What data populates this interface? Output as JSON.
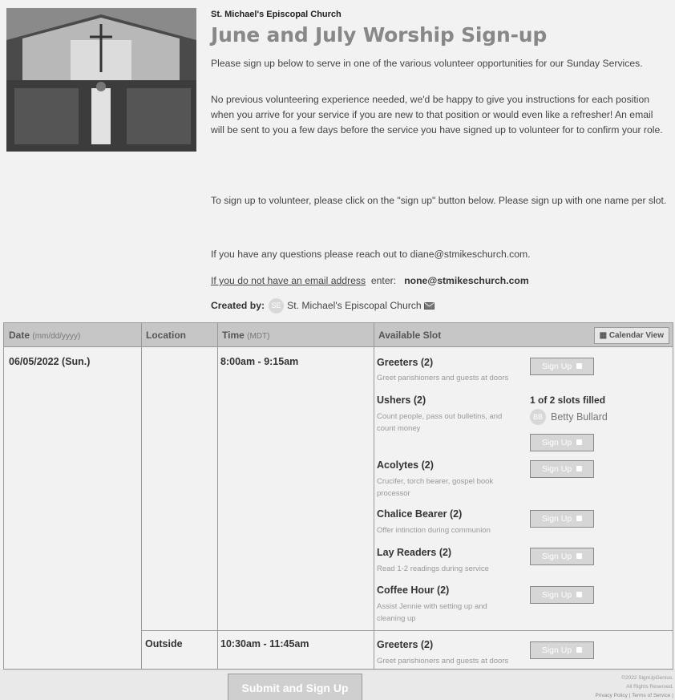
{
  "header": {
    "org_name": "St. Michael's Episcopal Church",
    "title": "June and July Worship Sign-up",
    "intro": "Please sign up below to serve in one of the various volunteer opportunities for our Sunday Services.",
    "details": "No previous volunteering experience needed, we'd be happy to give you instructions for each position when you arrive for your service if you are new to that position or would even like a refresher! An email will be sent to you a few days before the service you have signed up to volunteer for to confirm your role.",
    "instructions": "To sign up to volunteer, please click on the \"sign up\" button below. Please sign up with one name per slot.",
    "questions": "If you have any questions please reach out to diane@stmikeschurch.com.",
    "no_email_link": "If you do not have an email address",
    "no_email_enter": "enter:",
    "no_email_value": "none@stmikeschurch.com",
    "created_by_label": "Created by:",
    "creator_initials": "SE",
    "creator_name": "St. Michael's Episcopal Church"
  },
  "table": {
    "headers": {
      "date": "Date",
      "date_fmt": "(mm/dd/yyyy)",
      "location": "Location",
      "time": "Time",
      "time_zone": "(MDT)",
      "slot": "Available Slot"
    },
    "calendar_view": "Calendar View",
    "date": "06/05/2022 (Sun.)",
    "time1": "8:00am - 9:15am",
    "location2": "Outside",
    "time2": "10:30am - 11:45am",
    "signup_label": "Sign Up",
    "slots": [
      {
        "title": "Greeters (2)",
        "desc": "Greet parishioners and guests at doors"
      },
      {
        "title": "Ushers (2)",
        "desc": "Count people, pass out bulletins, and count money",
        "filled": "1 of 2 slots filled",
        "filler_initials": "BB",
        "filler_name": "Betty Bullard"
      },
      {
        "title": "Acolytes (2)",
        "desc": "Crucifer, torch bearer, gospel book processor"
      },
      {
        "title": "Chalice Bearer (2)",
        "desc": "Offer intinction during communion"
      },
      {
        "title": "Lay Readers (2)",
        "desc": "Read 1-2 readings during service"
      },
      {
        "title": "Coffee Hour (2)",
        "desc": "Assist Jennie with setting up and cleaning up"
      },
      {
        "title": "Greeters (2)",
        "desc": "Greet parishioners and guests at doors"
      }
    ]
  },
  "footer": {
    "submit": "Submit and Sign Up",
    "copyright": "©2022 SignUpGenius.",
    "rights": "All Rights Reserved.",
    "links": "Privacy Policy | Terms of Service |"
  }
}
